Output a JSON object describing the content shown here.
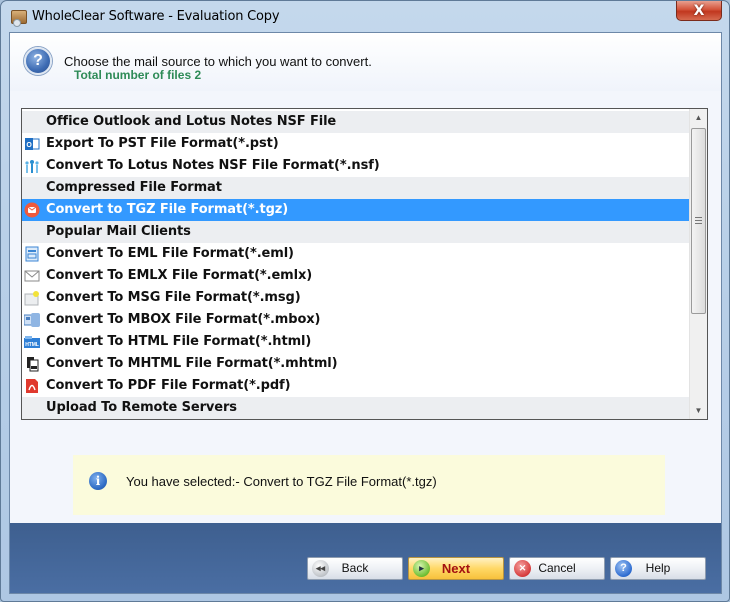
{
  "window": {
    "title": "WholeClear Software - Evaluation Copy",
    "close_label": "X"
  },
  "header": {
    "title": "Choose the mail source to which you want to convert.",
    "subtitle": "Total number of files 2",
    "icon": "question-icon"
  },
  "list": {
    "items": [
      {
        "type": "group",
        "label": "Office Outlook and Lotus Notes NSF File",
        "icon": ""
      },
      {
        "type": "item",
        "label": "Export To PST File Format(*.pst)",
        "icon": "outlook-icon"
      },
      {
        "type": "item",
        "label": "Convert To Lotus Notes NSF File Format(*.nsf)",
        "icon": "lotus-notes-icon"
      },
      {
        "type": "group",
        "label": "Compressed File Format",
        "icon": ""
      },
      {
        "type": "item",
        "label": "Convert to TGZ File Format(*.tgz)",
        "icon": "tgz-icon",
        "selected": true
      },
      {
        "type": "group",
        "label": "Popular Mail Clients",
        "icon": ""
      },
      {
        "type": "item",
        "label": "Convert To EML File Format(*.eml)",
        "icon": "eml-icon"
      },
      {
        "type": "item",
        "label": "Convert To EMLX File Format(*.emlx)",
        "icon": "envelope-icon"
      },
      {
        "type": "item",
        "label": "Convert To MSG File Format(*.msg)",
        "icon": "msg-icon"
      },
      {
        "type": "item",
        "label": "Convert To MBOX File Format(*.mbox)",
        "icon": "mbox-icon"
      },
      {
        "type": "item",
        "label": "Convert To HTML File Format(*.html)",
        "icon": "html-icon"
      },
      {
        "type": "item",
        "label": "Convert To MHTML File Format(*.mhtml)",
        "icon": "mhtml-icon"
      },
      {
        "type": "item",
        "label": "Convert To PDF File Format(*.pdf)",
        "icon": "pdf-icon"
      },
      {
        "type": "group",
        "label": "Upload To Remote Servers",
        "icon": ""
      }
    ],
    "selected_color": "#3399ff"
  },
  "info": {
    "text": "You have selected:- Convert to TGZ File Format(*.tgz)"
  },
  "footer": {
    "back_label": "Back",
    "next_label": "Next",
    "cancel_label": "Cancel",
    "help_label": "Help"
  }
}
